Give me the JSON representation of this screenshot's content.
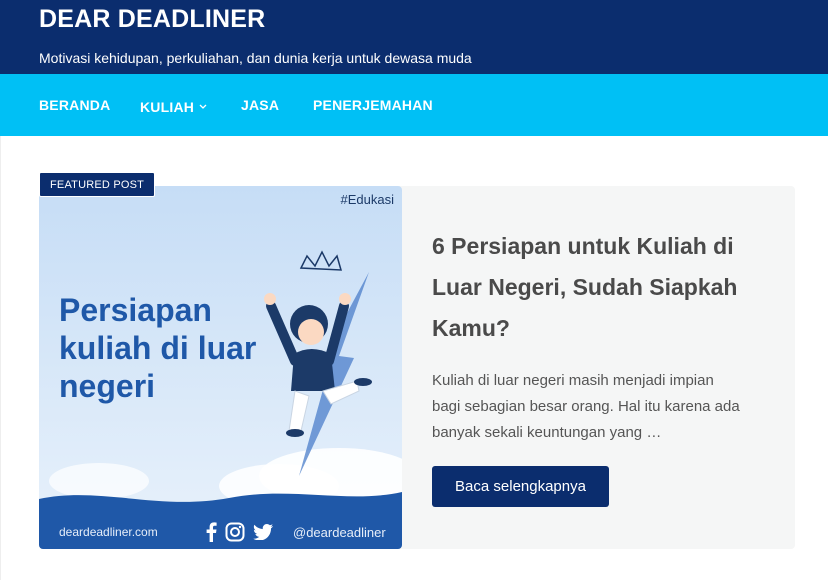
{
  "header": {
    "site_title": "DEAR DEADLINER",
    "tagline": "Motivasi kehidupan, perkuliahan, dan dunia kerja untuk dewasa muda"
  },
  "nav": {
    "items": [
      {
        "label": "BERANDA"
      },
      {
        "label": "KULIAH",
        "icon": "chevron-down-icon"
      },
      {
        "label": "JASA"
      },
      {
        "label": "PENERJEMAHAN"
      }
    ]
  },
  "featured": {
    "badge": "FEATURED POST",
    "image": {
      "hashtag": "#Edukasi",
      "headline": [
        "Persiapan",
        "kuliah di luar",
        "negeri"
      ],
      "website": "deardeadliner.com",
      "handle": "@deardeadliner",
      "social_icons": [
        "facebook-icon",
        "instagram-icon",
        "twitter-icon"
      ]
    },
    "title_lines": [
      "6 Persiapan untuk Kuliah di",
      "Luar Negeri, Sudah Siapkah",
      "Kamu?"
    ],
    "excerpt_lines": [
      "Kuliah di luar negeri masih menjadi impian",
      "bagi sebagian besar orang. Hal itu karena ada",
      "banyak sekali keuntungan yang …"
    ],
    "read_more": "Baca selengkapnya"
  },
  "colors": {
    "header_bg": "#0b2d6e",
    "nav_bg": "#00c0f5",
    "button_bg": "#0b2d6e",
    "image_text": "#1f58a8"
  }
}
